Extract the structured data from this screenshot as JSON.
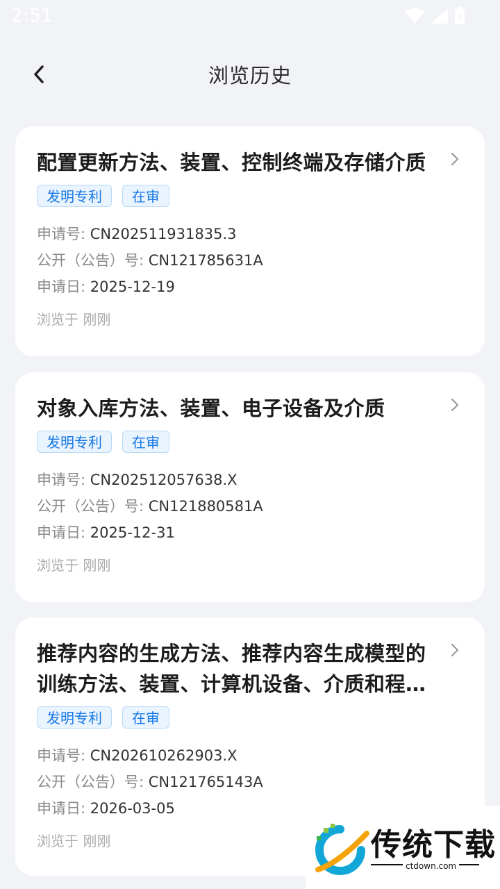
{
  "status": {
    "time": "2:51"
  },
  "header": {
    "title": "浏览历史"
  },
  "cards": [
    {
      "title": "配置更新方法、装置、控制终端及存储介质",
      "tags": [
        "发明专利",
        "在审"
      ],
      "app_no_label": "申请号: ",
      "app_no": "CN202511931835.3",
      "pub_no_label": "公开（公告）号: ",
      "pub_no": "CN121785631A",
      "app_date_label": "申请日: ",
      "app_date": "2025-12-19",
      "viewed": "浏览于 刚刚"
    },
    {
      "title": "对象入库方法、装置、电子设备及介质",
      "tags": [
        "发明专利",
        "在审"
      ],
      "app_no_label": "申请号: ",
      "app_no": "CN202512057638.X",
      "pub_no_label": "公开（公告）号: ",
      "pub_no": "CN121880581A",
      "app_date_label": "申请日: ",
      "app_date": "2025-12-31",
      "viewed": "浏览于 刚刚"
    },
    {
      "title": "推荐内容的生成方法、推荐内容生成模型的训练方法、装置、计算机设备、介质和程序产品",
      "tags": [
        "发明专利",
        "在审"
      ],
      "app_no_label": "申请号: ",
      "app_no": "CN202610262903.X",
      "pub_no_label": "公开（公告）号: ",
      "pub_no": "CN121765143A",
      "app_date_label": "申请日: ",
      "app_date": "2026-03-05",
      "viewed": "浏览于 刚刚"
    }
  ],
  "watermark": {
    "name": "传统下载",
    "url": "ctdown.com"
  },
  "colors": {
    "accent": "#1677e6",
    "background": "#f2f3f7",
    "tag_bg": "#eaf4ff"
  }
}
